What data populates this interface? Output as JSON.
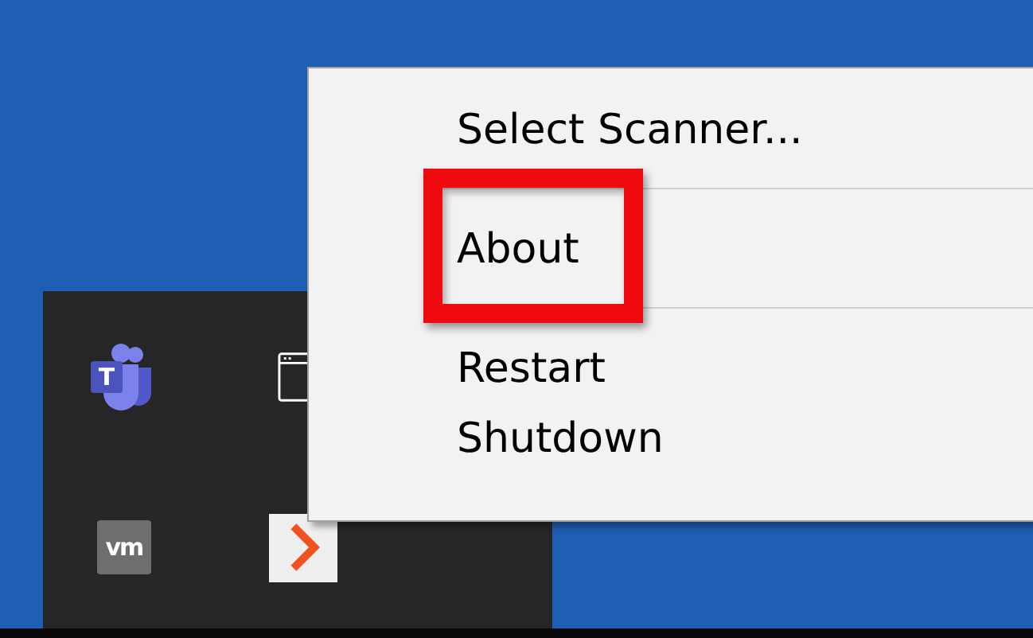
{
  "tray_icons": [
    {
      "kind": "teams",
      "letter": "T"
    },
    {
      "kind": "window"
    },
    {
      "kind": "vm",
      "letter": "vm"
    },
    {
      "kind": "arrow"
    }
  ],
  "context_menu": {
    "items": [
      {
        "kind": "item",
        "label": "Select Scanner...",
        "highlighted": false
      },
      {
        "kind": "separator"
      },
      {
        "kind": "item",
        "label": "About",
        "highlighted": true
      },
      {
        "kind": "separator"
      },
      {
        "kind": "item",
        "label": "Restart",
        "highlighted": false
      },
      {
        "kind": "item",
        "label": "Shutdown",
        "highlighted": false
      }
    ]
  }
}
